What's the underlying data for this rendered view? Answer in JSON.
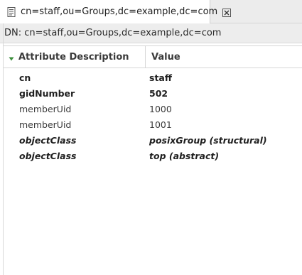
{
  "editor_tab": {
    "title": "cn=staff,ou=Groups,dc=example,dc=com",
    "icon": "entry-document-icon",
    "close_icon": "close-icon"
  },
  "dn_header": {
    "text": "DN: cn=staff,ou=Groups,dc=example,dc=com"
  },
  "table": {
    "columns": [
      {
        "label": "Attribute Description",
        "sort_icon": "sort-descending-icon"
      },
      {
        "label": "Value"
      }
    ],
    "rows": [
      {
        "attribute": "cn",
        "value": "staff",
        "style": "must"
      },
      {
        "attribute": "gidNumber",
        "value": "502",
        "style": "must"
      },
      {
        "attribute": "memberUid",
        "value": "1000",
        "style": "may"
      },
      {
        "attribute": "memberUid",
        "value": "1001",
        "style": "may"
      },
      {
        "attribute": "objectClass",
        "value": "posixGroup (structural)",
        "style": "objectclass"
      },
      {
        "attribute": "objectClass",
        "value": "top (abstract)",
        "style": "objectclass"
      }
    ]
  },
  "colors": {
    "sort_indicator": "#3c8f3c",
    "tab_background": "#ffffff",
    "header_background": "#ededed"
  }
}
